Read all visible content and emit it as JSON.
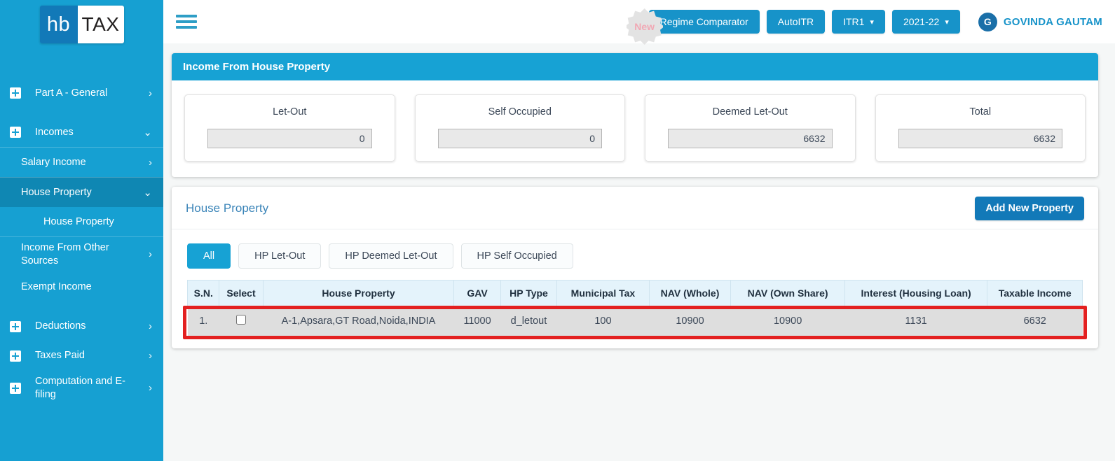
{
  "brand": {
    "logo_left": "hb",
    "logo_right": "TAX"
  },
  "sidebar": {
    "items": [
      {
        "label": "Part A - General",
        "icon": "plus-box-icon",
        "chevron": "›"
      },
      {
        "label": "Incomes",
        "icon": "plus-box-icon",
        "chevron": "⌄"
      },
      {
        "label": "Salary Income",
        "chevron": "›"
      },
      {
        "label": "House Property",
        "chevron": "⌄"
      },
      {
        "label": "House Property"
      },
      {
        "label": "Income From Other Sources",
        "chevron": "›"
      },
      {
        "label": "Exempt Income"
      },
      {
        "label": "Deductions",
        "icon": "plus-box-icon",
        "chevron": "›"
      },
      {
        "label": "Taxes Paid",
        "icon": "plus-box-icon",
        "chevron": "›"
      },
      {
        "label": "Computation and E-filing",
        "icon": "plus-box-icon",
        "chevron": "›"
      }
    ]
  },
  "topbar": {
    "menu_icon": "hamburger-icon",
    "new_badge": "New",
    "regime_comparator": "Regime Comparator",
    "autoitr": "AutoITR",
    "itr_form": "ITR1",
    "assessment_year": "2021-22",
    "caret": "❯",
    "user": {
      "initial": "G",
      "name": "GOVINDA GAUTAM"
    }
  },
  "income_card": {
    "title": "Income From House Property",
    "summary": [
      {
        "label": "Let-Out",
        "value": "0"
      },
      {
        "label": "Self Occupied",
        "value": "0"
      },
      {
        "label": "Deemed Let-Out",
        "value": "6632"
      },
      {
        "label": "Total",
        "value": "6632"
      }
    ]
  },
  "house_property": {
    "title": "House Property",
    "add_button": "Add New Property",
    "filters": [
      {
        "label": "All",
        "active": true
      },
      {
        "label": "HP Let-Out",
        "active": false
      },
      {
        "label": "HP Deemed Let-Out",
        "active": false
      },
      {
        "label": "HP Self Occupied",
        "active": false
      }
    ],
    "columns": [
      "S.N.",
      "Select",
      "House Property",
      "GAV",
      "HP Type",
      "Municipal Tax",
      "NAV (Whole)",
      "NAV (Own Share)",
      "Interest (Housing Loan)",
      "Taxable Income"
    ],
    "rows": [
      {
        "sn": "1.",
        "selected": false,
        "property": "A-1,Apsara,GT Road,Noida,INDIA",
        "gav": "11000",
        "hp_type": "d_letout",
        "municipal_tax": "100",
        "nav_whole": "10900",
        "nav_own_share": "10900",
        "interest_housing_loan": "1131",
        "taxable_income": "6632",
        "highlighted": true
      }
    ]
  },
  "colors": {
    "sidebar": "#16a0d2",
    "sidebar_active": "#0f87b3",
    "accent": "#17a2d4",
    "primary_button": "#1279b8",
    "highlight_border": "#e32020",
    "link_text": "#3a84b8"
  }
}
